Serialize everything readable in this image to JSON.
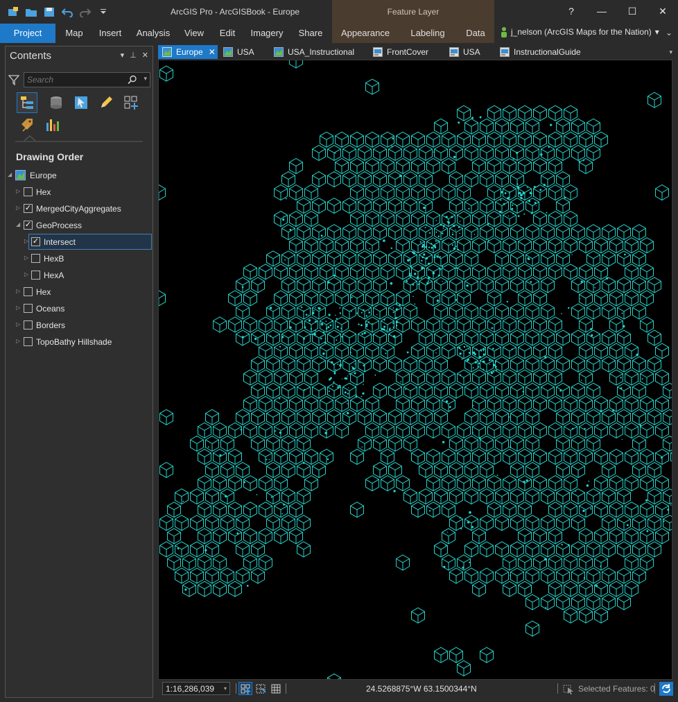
{
  "window": {
    "title": "ArcGIS Pro - ArcGISBook - Europe",
    "contextual_tab_group": "Feature Layer",
    "help": "?",
    "minimize": "—",
    "maximize": "☐",
    "close": "✕"
  },
  "ribbon": {
    "tabs": [
      {
        "label": "Project"
      },
      {
        "label": "Map"
      },
      {
        "label": "Insert"
      },
      {
        "label": "Analysis"
      },
      {
        "label": "View"
      },
      {
        "label": "Edit"
      },
      {
        "label": "Imagery"
      },
      {
        "label": "Share"
      },
      {
        "label": "Appearance"
      },
      {
        "label": "Labeling"
      },
      {
        "label": "Data"
      }
    ],
    "user": "j_nelson (ArcGIS Maps for the Nation)",
    "user_drop": "▾",
    "collapse": "⌄"
  },
  "contents": {
    "title": "Contents",
    "menu_glyph": "▾",
    "pin_glyph": "⊥",
    "close_glyph": "✕",
    "search_placeholder": "Search",
    "search_drop": "▾",
    "drawing_order_label": "Drawing Order",
    "layers": [
      {
        "label": "Europe",
        "expand": "◢",
        "checked": null
      },
      {
        "label": "Hex",
        "expand": "▷",
        "checked": false
      },
      {
        "label": "MergedCityAggregates",
        "expand": "▷",
        "checked": true
      },
      {
        "label": "GeoProcess",
        "expand": "◢",
        "checked": true
      },
      {
        "label": "Intersect",
        "expand": "▷",
        "checked": true,
        "selected": true
      },
      {
        "label": "HexB",
        "expand": "▷",
        "checked": false
      },
      {
        "label": "HexA",
        "expand": "▷",
        "checked": false
      },
      {
        "label": "Hex",
        "expand": "▷",
        "checked": false
      },
      {
        "label": "Oceans",
        "expand": "▷",
        "checked": false
      },
      {
        "label": "Borders",
        "expand": "▷",
        "checked": false
      },
      {
        "label": "TopoBathy Hillshade",
        "expand": "▷",
        "checked": false
      }
    ],
    "check_glyph": "✓"
  },
  "view_tabs": [
    {
      "label": "Europe",
      "type": "map",
      "active": true
    },
    {
      "label": "USA",
      "type": "map"
    },
    {
      "label": "USA_Instructional",
      "type": "map"
    },
    {
      "label": "FrontCover",
      "type": "layout"
    },
    {
      "label": "USA",
      "type": "layout"
    },
    {
      "label": "InstructionalGuide",
      "type": "layout"
    }
  ],
  "view_tab_close": "✕",
  "view_tab_overflow": "▾",
  "map": {
    "feature_color": "#27d3cc",
    "background": "#000000"
  },
  "status": {
    "scale": "1:16,286,039",
    "scale_drop": "▾",
    "coordinates": "24.5268875°W 63.1500344°N",
    "selected_features": "Selected Features: 0"
  },
  "colors": {
    "accent": "#1e79c9",
    "contextual": "#4a3c2e"
  }
}
